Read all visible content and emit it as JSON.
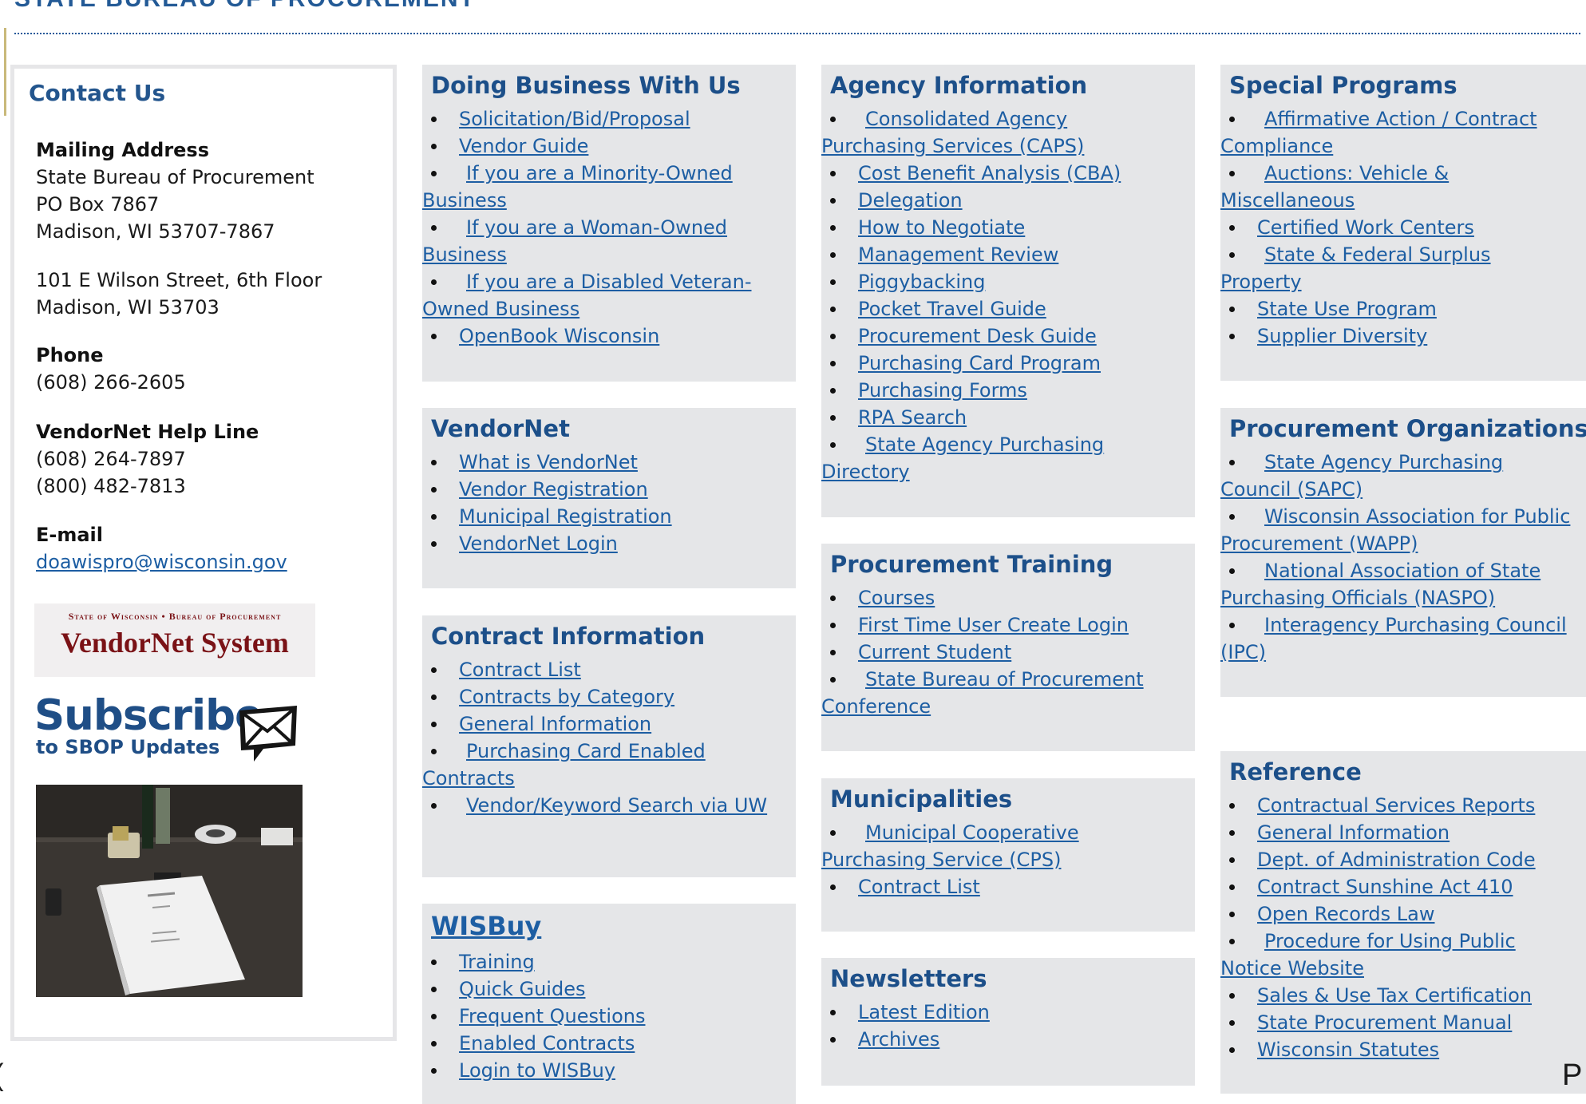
{
  "page": {
    "heading": "STATE BUREAU OF PROCUREMENT",
    "left_edge_text": "(",
    "right_edge_text": "P"
  },
  "contact": {
    "title": "Contact Us",
    "mailing_label": "Mailing Address",
    "mailing_lines": [
      "State Bureau of Procurement",
      "PO Box 7867",
      "Madison, WI 53707-7867"
    ],
    "street_lines": [
      "101 E Wilson Street, 6th Floor",
      "Madison, WI 53703"
    ],
    "phone_label": "Phone",
    "phone": "(608) 266-2605",
    "helpline_label": "VendorNet Help Line",
    "helpline_lines": [
      "(608) 264-7897",
      "(800) 482-7813"
    ],
    "email_label": "E-mail",
    "email": "doawispro@wisconsin.gov",
    "vendornet_banner": {
      "small": "State of Wisconsin • Bureau of Procurement",
      "big": "VendorNet System"
    },
    "subscribe_banner": {
      "big": "Subscribe",
      "small": "to SBOP Updates",
      "icon": "envelope-icon"
    },
    "photo_icon": "desk-photo-image"
  },
  "panels": {
    "doing_business": {
      "title": "Doing Business With Us",
      "links": [
        "Solicitation/Bid/Proposal",
        "Vendor Guide",
        "If you are a Minority-Owned Business",
        "If you are a Woman-Owned Business",
        "If you are a Disabled Veteran-Owned Business",
        "OpenBook Wisconsin"
      ]
    },
    "vendornet": {
      "title": "VendorNet",
      "links": [
        "What is VendorNet",
        "Vendor Registration",
        "Municipal Registration",
        "VendorNet Login"
      ]
    },
    "contract_info": {
      "title": "Contract Information",
      "links": [
        "Contract List",
        "Contracts by Category",
        "General Information",
        "Purchasing Card Enabled Contracts",
        "Vendor/Keyword Search via UW"
      ]
    },
    "wisbuy": {
      "title": "WISBuy",
      "links": [
        "Training ",
        "Quick Guides",
        "Frequent Questions",
        "Enabled Contracts",
        "Login to WISBuy"
      ]
    },
    "agency_info": {
      "title": "Agency Information",
      "links": [
        "Consolidated Agency Purchasing Services (CAPS)",
        "Cost Benefit Analysis (CBA)",
        "Delegation",
        "How to Negotiate",
        "Management Review",
        "Piggybacking",
        "Pocket Travel Guide",
        "Procurement Desk Guide",
        "Purchasing Card Program",
        "Purchasing Forms",
        "RPA Search",
        "State Agency Purchasing Directory"
      ]
    },
    "training": {
      "title": "Procurement Training",
      "links": [
        "Courses",
        "First Time User Create Login",
        "Current Student",
        "State Bureau of Procurement Conference"
      ]
    },
    "municipalities": {
      "title": "Municipalities",
      "links": [
        "Municipal Cooperative Purchasing Service (CPS)",
        "Contract List"
      ]
    },
    "newsletters": {
      "title": "Newsletters",
      "links": [
        "Latest Edition",
        "Archives"
      ]
    },
    "special_programs": {
      "title": "Special Programs",
      "links": [
        "Affirmative Action / Contract Compliance",
        "Auctions: Vehicle & Miscellaneous",
        "Certified Work Centers",
        "State & Federal Surplus Property",
        "State Use Program",
        "Supplier Diversity"
      ]
    },
    "proc_orgs": {
      "title": "Procurement Organizations",
      "links": [
        "State Agency Purchasing Council (SAPC)",
        "Wisconsin Association for Public Procurement (WAPP)",
        "National Association of State Purchasing Officials (NASPO)",
        "Interagency Purchasing Council (IPC)"
      ]
    },
    "reference": {
      "title": "Reference",
      "links": [
        "Contractual Services Reports",
        "General Information",
        "Dept. of Administration Code",
        "Contract Sunshine Act 410",
        "Open Records Law",
        "Procedure for Using Public Notice Website",
        "Sales & Use Tax Certification",
        "State Procurement Manual",
        "Wisconsin Statutes"
      ]
    }
  }
}
